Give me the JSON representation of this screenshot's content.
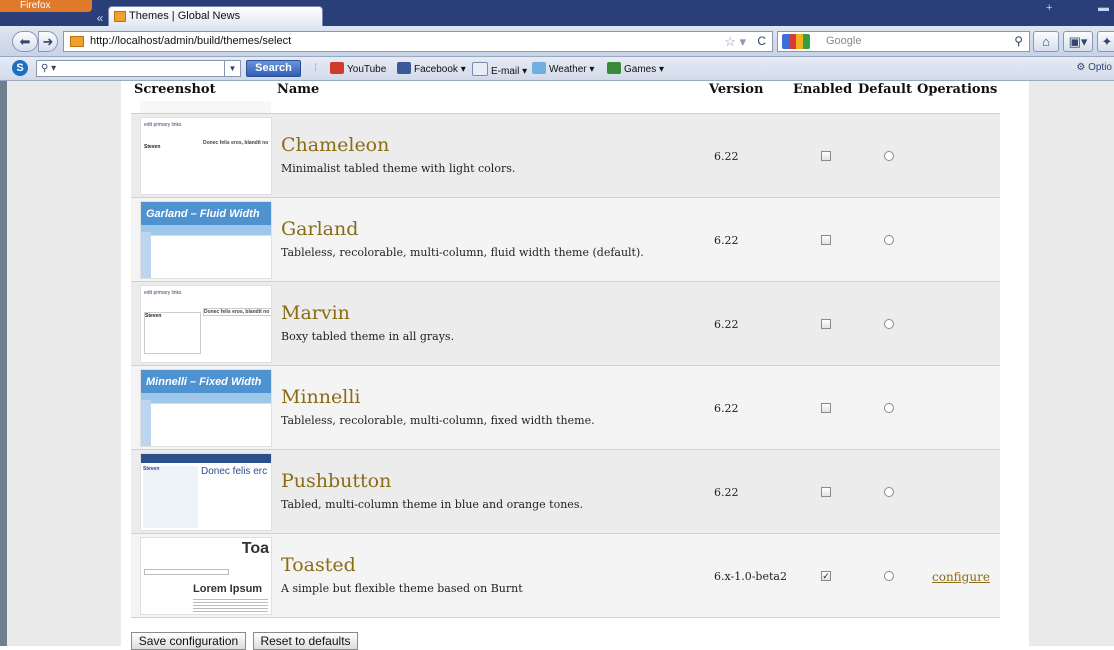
{
  "browser": {
    "app_button": "Firefox",
    "tab_title": "Themes | Global News",
    "url": "http://localhost/admin/build/themes/select",
    "search_engine_placeholder": "Google",
    "toolbar": {
      "search_button": "Search",
      "bookmarks": [
        "YouTube",
        "Facebook ▾",
        "E-mail ▾",
        "Weather ▾",
        "Games ▾"
      ],
      "right_label": "Optio"
    }
  },
  "table": {
    "headers": {
      "screenshot": "Screenshot",
      "name": "Name",
      "version": "Version",
      "enabled": "Enabled",
      "default": "Default",
      "operations": "Operations"
    },
    "rows": [
      {
        "name": "Chameleon",
        "description": "Minimalist tabled theme with light colors.",
        "version": "6.22",
        "enabled": false,
        "default": false,
        "operations": ""
      },
      {
        "name": "Garland",
        "description": "Tableless, recolorable, multi-column, fluid width theme (default).",
        "version": "6.22",
        "enabled": false,
        "default": false,
        "operations": ""
      },
      {
        "name": "Marvin",
        "description": "Boxy tabled theme in all grays.",
        "version": "6.22",
        "enabled": false,
        "default": false,
        "operations": ""
      },
      {
        "name": "Minnelli",
        "description": "Tableless, recolorable, multi-column, fixed width theme.",
        "version": "6.22",
        "enabled": false,
        "default": false,
        "operations": ""
      },
      {
        "name": "Pushbutton",
        "description": "Tabled, multi-column theme in blue and orange tones.",
        "version": "6.22",
        "enabled": false,
        "default": false,
        "operations": ""
      },
      {
        "name": "Toasted",
        "description": "A simple but flexible theme based on Burnt",
        "version": "6.x-1.0-beta2",
        "enabled": true,
        "default": false,
        "operations": "configure"
      }
    ]
  },
  "thumbnails": {
    "garland_banner": "Garland – Fluid Width",
    "minnelli_banner": "Minnelli – Fixed Width",
    "toasted_title": "Toa",
    "toasted_heading": "Lorem Ipsum",
    "pushbutton_heading": "Donec felis erc",
    "zen_links": "edit primary links",
    "zen_site": "Steven",
    "zen_heading": "Donec felis eros, blandit no"
  },
  "actions": {
    "save": "Save configuration",
    "reset": "Reset to defaults"
  }
}
